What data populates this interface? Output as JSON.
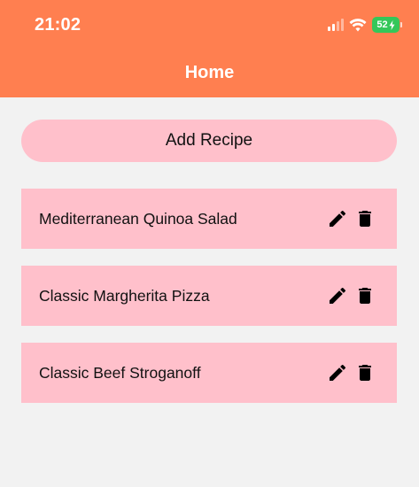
{
  "status_bar": {
    "time": "21:02",
    "battery": "52",
    "icons": [
      "signal-icon",
      "wifi-icon",
      "battery-charging-icon"
    ]
  },
  "header": {
    "title": "Home"
  },
  "actions": {
    "add_recipe_label": "Add Recipe"
  },
  "recipes": [
    {
      "name": "Mediterranean Quinoa Salad",
      "icons": [
        "edit-pencil-icon",
        "delete-trash-icon"
      ]
    },
    {
      "name": "Classic Margherita Pizza",
      "icons": [
        "edit-pencil-icon",
        "delete-trash-icon"
      ]
    },
    {
      "name": "Classic Beef Stroganoff",
      "icons": [
        "edit-pencil-icon",
        "delete-trash-icon"
      ]
    }
  ],
  "colors": {
    "header": "#ff7f50",
    "background": "#f2f2f2",
    "card": "#ffc0cb",
    "battery": "#34c759",
    "text": "#111111"
  }
}
